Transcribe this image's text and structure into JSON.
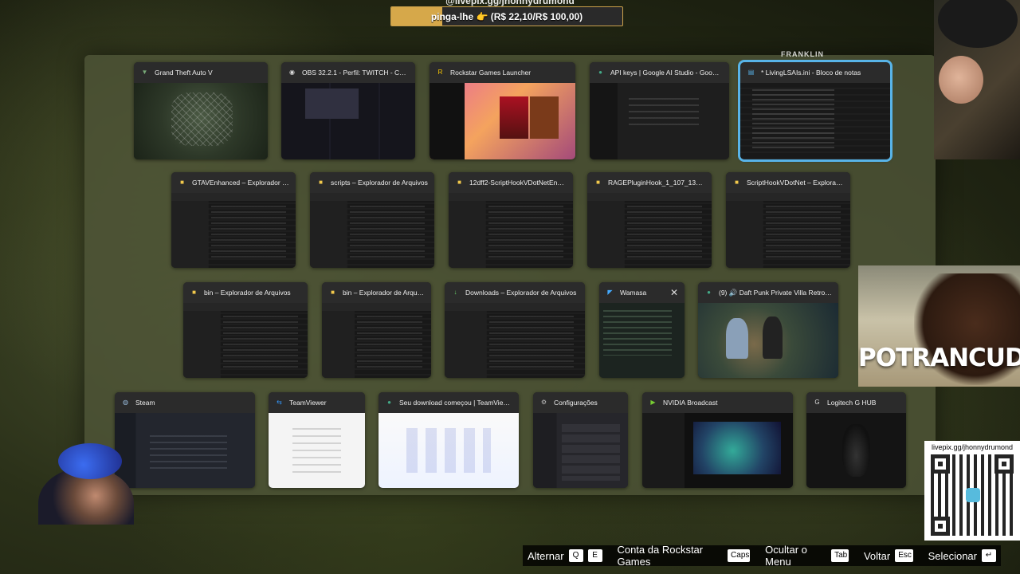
{
  "donation": {
    "handle": "@livepix.gg/jhonnydrumond",
    "label": "pinga-lhe 👉 (R$ 22,10/R$ 100,00)",
    "progress": 0.221
  },
  "franklin_label": "FRANKLIN",
  "rows": [
    [
      {
        "title": "Grand Theft Auto V",
        "icon": "gta-icon",
        "thumb": "t-gta"
      },
      {
        "title": "OBS 32.2.1 - Perfil: TWITCH - Cenas:...",
        "icon": "obs-icon",
        "thumb": "t-obs"
      },
      {
        "title": "Rockstar Games Launcher",
        "icon": "rockstar-icon",
        "thumb": "t-rockstar"
      },
      {
        "title": "API keys | Google AI Studio - Google C...",
        "icon": "chrome-icon",
        "thumb": "t-dark-ui"
      },
      {
        "title": "* LivingLSAIs.ini - Bloco de notas",
        "icon": "notepad-icon",
        "thumb": "t-code",
        "selected": true
      }
    ],
    [
      {
        "title": "GTAVEnhanced – Explorador de...",
        "icon": "folder-icon",
        "thumb": "t-explorer"
      },
      {
        "title": "scripts – Explorador de Arquivos",
        "icon": "folder-icon",
        "thumb": "t-explorer"
      },
      {
        "title": "12dff2-ScriptHookVDotNetEnhan...",
        "icon": "folder-icon",
        "thumb": "t-explorer"
      },
      {
        "title": "RAGEPluginHook_1_107_1334_165...",
        "icon": "folder-icon",
        "thumb": "t-explorer"
      },
      {
        "title": "ScriptHookVDotNet – Explorador...",
        "icon": "folder-icon",
        "thumb": "t-explorer"
      }
    ],
    [
      {
        "title": "bin – Explorador de Arquivos",
        "icon": "folder-icon",
        "thumb": "t-explorer"
      },
      {
        "title": "bin – Explorador de Arquivos",
        "icon": "folder-icon",
        "thumb": "t-explorer"
      },
      {
        "title": "Downloads – Explorador de Arquivos",
        "icon": "download-icon",
        "thumb": "t-explorer"
      },
      {
        "title": "Wamasa",
        "icon": "vscode-icon",
        "thumb": "t-wamasa",
        "close": "✕"
      },
      {
        "title": "(9) 🔊 Daft Punk Private Villa Retro Lo...",
        "icon": "chrome-icon",
        "thumb": "t-daftpunk"
      }
    ],
    [
      {
        "title": "Steam",
        "icon": "steam-icon",
        "thumb": "t-steam"
      },
      {
        "title": "TeamViewer",
        "icon": "teamviewer-icon",
        "thumb": "t-light"
      },
      {
        "title": "Seu download começou | TeamViewer...",
        "icon": "chrome-icon",
        "thumb": "t-web"
      },
      {
        "title": "Configurações",
        "icon": "settings-icon",
        "thumb": "t-settings"
      },
      {
        "title": "NVIDIA Broadcast",
        "icon": "nvidia-icon",
        "thumb": "t-nvidia"
      },
      {
        "title": "Logitech G HUB",
        "icon": "ghub-icon",
        "thumb": "t-ghub"
      }
    ]
  ],
  "horse_banner": "POTRANCUDA",
  "qr": {
    "url": "livepix.gg/jhonnydrumond"
  },
  "hints": [
    {
      "label": "Alternar",
      "keys": [
        "Q",
        "E"
      ]
    },
    {
      "label": "Conta da Rockstar Games",
      "keys": [
        "Caps"
      ]
    },
    {
      "label": "Ocultar o Menu",
      "keys": [
        "Tab"
      ]
    },
    {
      "label": "Voltar",
      "keys": [
        "Esc"
      ]
    },
    {
      "label": "Selecionar",
      "keys": [
        "↵"
      ]
    }
  ],
  "colors": {
    "selected_outline": "#58b4e8",
    "donation_fill": "#d6a84a",
    "panel": "#4e5437"
  }
}
